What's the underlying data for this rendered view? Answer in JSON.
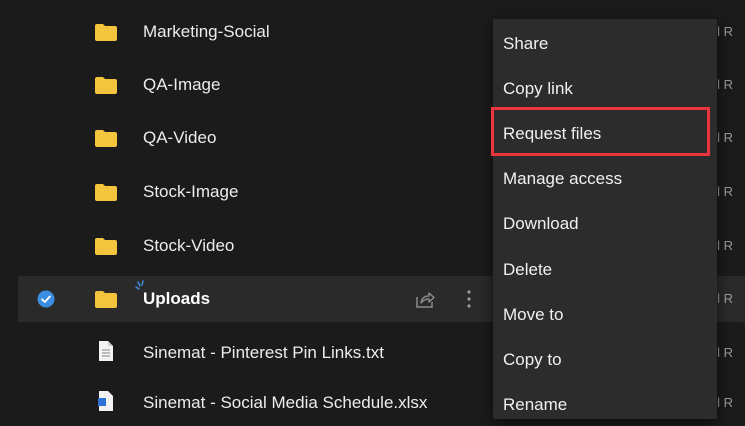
{
  "files": [
    {
      "name": "Marketing-Social",
      "type": "folder",
      "owner": "eil R"
    },
    {
      "name": "QA-Image",
      "type": "folder",
      "owner": "eil R"
    },
    {
      "name": "QA-Video",
      "type": "folder",
      "owner": "eil R"
    },
    {
      "name": "Stock-Image",
      "type": "folder",
      "owner": "eil R"
    },
    {
      "name": "Stock-Video",
      "type": "folder",
      "owner": "eil R"
    },
    {
      "name": "Uploads",
      "type": "folder",
      "owner": "eil R",
      "selected": true
    },
    {
      "name": "Sinemat - Pinterest Pin Links.txt",
      "type": "text-file",
      "owner": "eil R"
    },
    {
      "name": "Sinemat - Social Media Schedule.xlsx",
      "type": "document-file",
      "owner": "eil R"
    }
  ],
  "context_menu": {
    "items": [
      {
        "label": "Share"
      },
      {
        "label": "Copy link"
      },
      {
        "label": "Request files",
        "highlighted": true
      },
      {
        "label": "Manage access"
      },
      {
        "label": "Download"
      },
      {
        "label": "Delete"
      },
      {
        "label": "Move to"
      },
      {
        "label": "Copy to"
      },
      {
        "label": "Rename"
      }
    ]
  },
  "colors": {
    "background": "#1c1b1b",
    "selected_row": "#2b2a2a",
    "folder": "#f3c53c",
    "check_accent": "#3b8fe3",
    "menu_background": "#2d2c2c",
    "highlight_border": "#e8363c"
  }
}
